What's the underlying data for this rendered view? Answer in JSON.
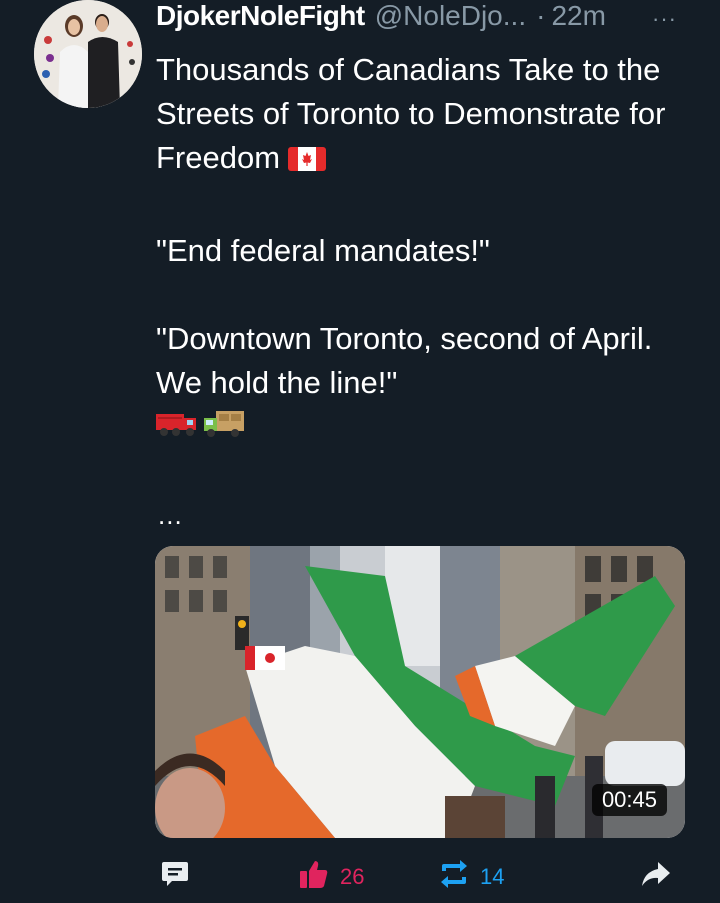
{
  "author": {
    "display_name": "DjokerNoleFight",
    "handle": "@NoleDjo...",
    "dot": "·",
    "time": "22m"
  },
  "more_label": "···",
  "tweet": {
    "line1": "Thousands of Canadians Take to the Streets of Toronto to Demonstrate for Freedom",
    "line2": "\"End federal mandates!\"",
    "line3": "\"Downtown Toronto, second of April. We hold the line!\"",
    "emojis": [
      "truck-emoji",
      "delivery-truck-emoji"
    ],
    "flag_emoji": "canada-flag-emoji",
    "ellipsis": "..."
  },
  "media": {
    "duration": "00:45"
  },
  "actions": {
    "reply_icon": "reply-icon",
    "like_count": "26",
    "like_color": "#e0245e",
    "retweet_count": "14",
    "retweet_color": "#1da1f2",
    "share_icon": "share-icon"
  },
  "colors": {
    "background": "#141d26",
    "secondary_text": "#8899a6"
  }
}
